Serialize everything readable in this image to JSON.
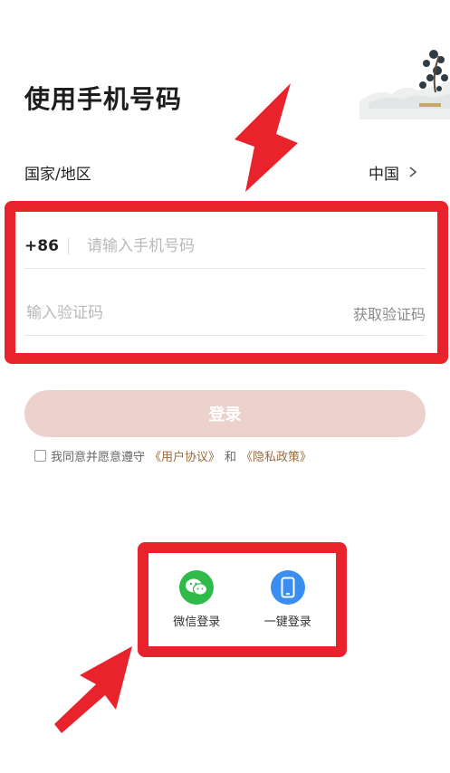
{
  "page": {
    "title": "使用手机号码"
  },
  "region": {
    "label": "国家/地区",
    "value": "中国"
  },
  "phone": {
    "country_code": "+86",
    "placeholder": "请输入手机号码"
  },
  "verify": {
    "placeholder": "输入验证码",
    "get_code_label": "获取验证码"
  },
  "login": {
    "button_label": "登录"
  },
  "agreement": {
    "prefix": "我同意并愿意遵守",
    "user_agreement": "《用户协议》",
    "and": "和",
    "privacy_policy": "《隐私政策》"
  },
  "social": {
    "wechat_label": "微信登录",
    "oneclick_label": "一键登录"
  },
  "colors": {
    "highlight": "#e8232c",
    "login_button": "#ecd1cc",
    "wechat": "#2ebb4a",
    "oneclick": "#3a8ef0",
    "link": "#9a6b3b"
  },
  "icons": [
    "chevron-right-icon",
    "wechat-icon",
    "phone-icon",
    "arrow-icon"
  ]
}
